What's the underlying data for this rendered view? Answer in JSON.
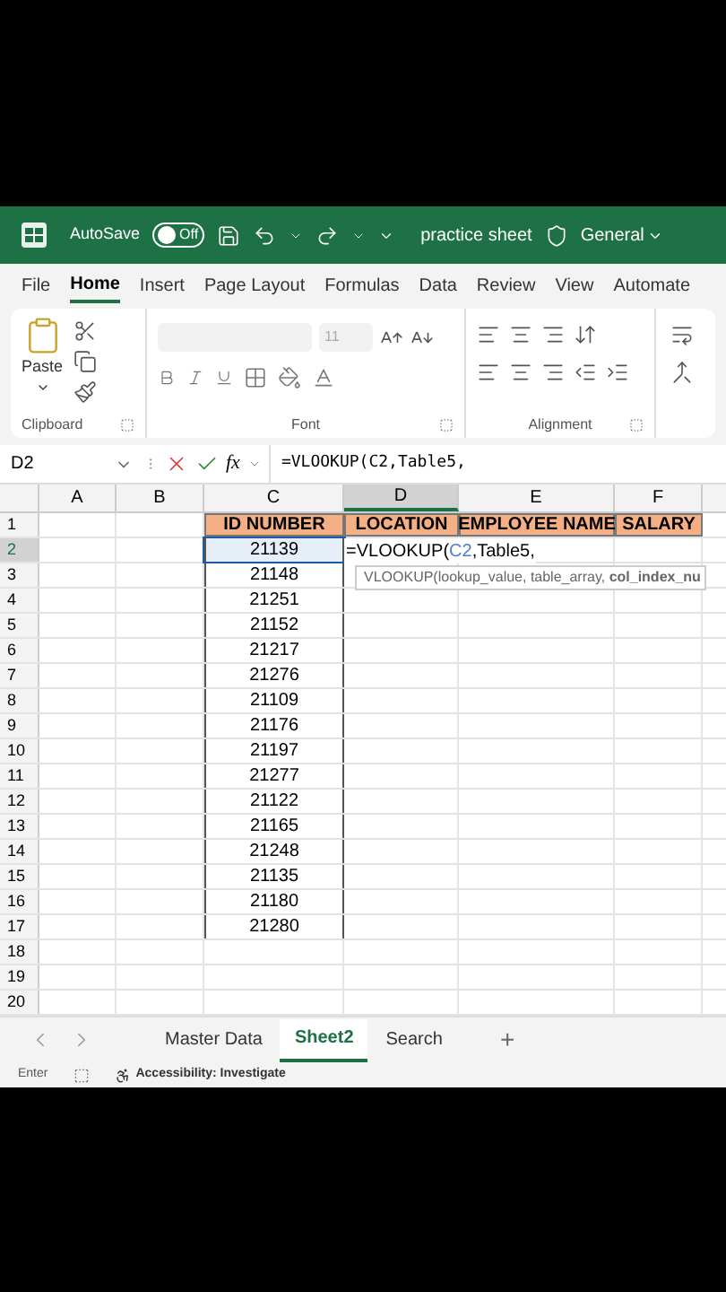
{
  "title_bar": {
    "autosave_label": "AutoSave",
    "autosave": {
      "on": false,
      "label": "Off"
    },
    "file_name": "practice sheet",
    "sensitivity": "General"
  },
  "tabs": [
    {
      "label": "File",
      "selected": false
    },
    {
      "label": "Home",
      "selected": true
    },
    {
      "label": "Insert",
      "selected": false
    },
    {
      "label": "Page Layout",
      "selected": false
    },
    {
      "label": "Formulas",
      "selected": false
    },
    {
      "label": "Data",
      "selected": false
    },
    {
      "label": "Review",
      "selected": false
    },
    {
      "label": "View",
      "selected": false
    },
    {
      "label": "Automate",
      "selected": false
    }
  ],
  "ribbon": {
    "paste_label": "Paste",
    "font_size": "11",
    "groups": [
      "Clipboard",
      "Font",
      "Alignment"
    ]
  },
  "formula_bar": {
    "name_box": "D2",
    "function_label": "fx",
    "formula": "=VLOOKUP(C2,Table5,"
  },
  "columns": [
    {
      "label": "A",
      "selected": false
    },
    {
      "label": "B",
      "selected": false
    },
    {
      "label": "C",
      "selected": false
    },
    {
      "label": "D",
      "selected": true
    },
    {
      "label": "E",
      "selected": false
    },
    {
      "label": "F",
      "selected": false
    }
  ],
  "rows": [
    {
      "number": "1",
      "kind": "header",
      "selected": false,
      "c": "ID NUMBER",
      "d": "LOCATION",
      "e": "EMPLOYEE NAME",
      "f": "SALARY"
    },
    {
      "number": "2",
      "kind": "data",
      "selected": true,
      "c": "21139"
    },
    {
      "number": "3",
      "kind": "data",
      "selected": false,
      "c": "21148"
    },
    {
      "number": "4",
      "kind": "data",
      "selected": false,
      "c": "21251"
    },
    {
      "number": "5",
      "kind": "data",
      "selected": false,
      "c": "21152"
    },
    {
      "number": "6",
      "kind": "data",
      "selected": false,
      "c": "21217"
    },
    {
      "number": "7",
      "kind": "data",
      "selected": false,
      "c": "21276"
    },
    {
      "number": "8",
      "kind": "data",
      "selected": false,
      "c": "21109"
    },
    {
      "number": "9",
      "kind": "data",
      "selected": false,
      "c": "21176"
    },
    {
      "number": "10",
      "kind": "data",
      "selected": false,
      "c": "21197"
    },
    {
      "number": "11",
      "kind": "data",
      "selected": false,
      "c": "21277"
    },
    {
      "number": "12",
      "kind": "data",
      "selected": false,
      "c": "21122"
    },
    {
      "number": "13",
      "kind": "data",
      "selected": false,
      "c": "21165"
    },
    {
      "number": "14",
      "kind": "data",
      "selected": false,
      "c": "21248"
    },
    {
      "number": "15",
      "kind": "data",
      "selected": false,
      "c": "21135"
    },
    {
      "number": "16",
      "kind": "data",
      "selected": false,
      "c": "21180"
    },
    {
      "number": "17",
      "kind": "data",
      "selected": false,
      "c": "21280"
    },
    {
      "number": "18",
      "kind": "empty",
      "selected": false
    },
    {
      "number": "19",
      "kind": "empty",
      "selected": false
    },
    {
      "number": "20",
      "kind": "empty",
      "selected": false
    }
  ],
  "editing_cell": {
    "parts": [
      {
        "kind": "text",
        "text": "=VLOOKUP("
      },
      {
        "kind": "reference",
        "text": "C2"
      },
      {
        "kind": "text",
        "text": ",Table5,"
      }
    ],
    "tooltip": "VLOOKUP(lookup_value, table_array, **col_index_nu**"
  },
  "sheet_tabs": [
    {
      "label": "Master Data",
      "selected": false
    },
    {
      "label": "Sheet2",
      "selected": true
    },
    {
      "label": "Search",
      "selected": false
    }
  ],
  "add_sheet": "+",
  "status_bar": {
    "mode": "Enter",
    "accessibility": "Accessibility: Investigate"
  }
}
